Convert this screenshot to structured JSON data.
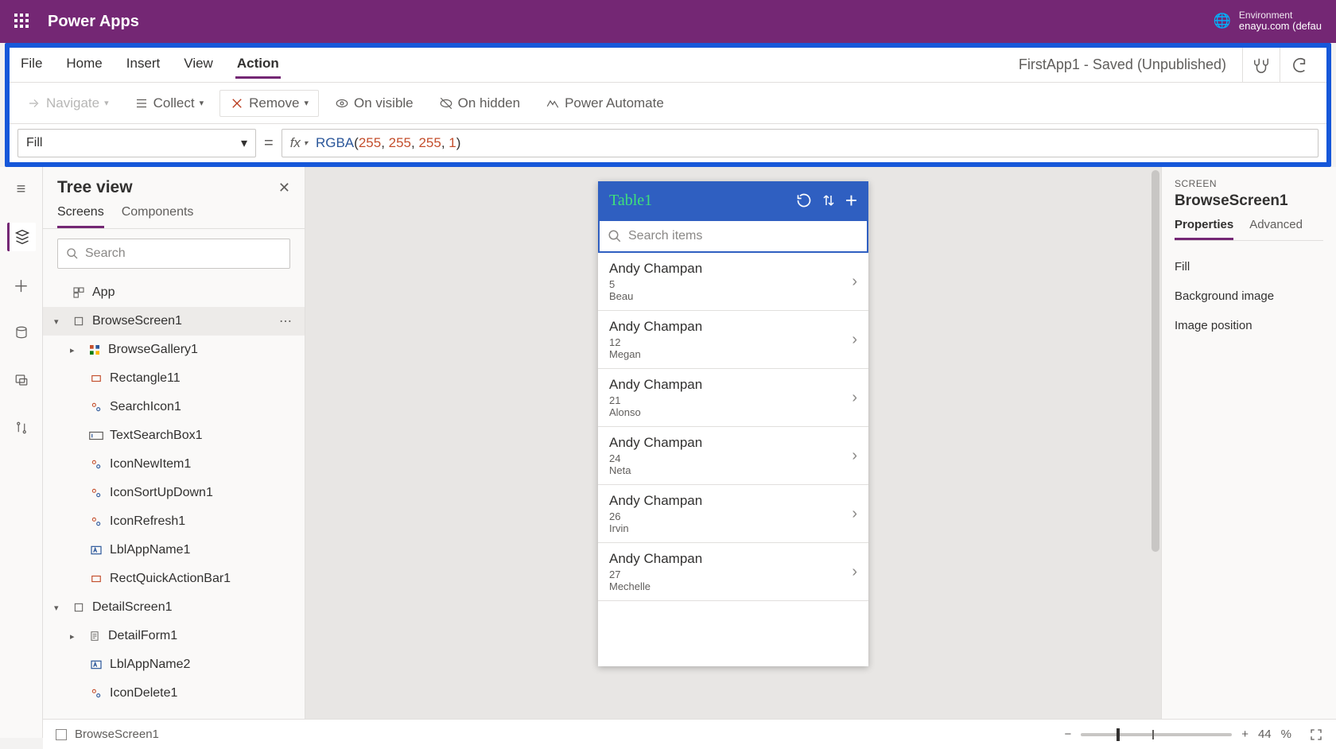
{
  "titlebar": {
    "app": "Power Apps",
    "env_label": "Environment",
    "env_value": "enayu.com (defau"
  },
  "menu": {
    "items": [
      "File",
      "Home",
      "Insert",
      "View",
      "Action"
    ],
    "active": "Action",
    "doc_status": "FirstApp1 - Saved (Unpublished)"
  },
  "toolbar": {
    "navigate": "Navigate",
    "collect": "Collect",
    "remove": "Remove",
    "on_visible": "On visible",
    "on_hidden": "On hidden",
    "power_automate": "Power Automate"
  },
  "formula": {
    "property": "Fill",
    "fx": "fx",
    "fn": "RGBA",
    "args": [
      "255",
      "255",
      "255",
      "1"
    ]
  },
  "treeview": {
    "title": "Tree view",
    "tabs": [
      "Screens",
      "Components"
    ],
    "search_placeholder": "Search",
    "nodes": {
      "app": "App",
      "browse": "BrowseScreen1",
      "gallery": "BrowseGallery1",
      "rect11": "Rectangle11",
      "searchicon": "SearchIcon1",
      "textsearch": "TextSearchBox1",
      "iconnew": "IconNewItem1",
      "iconsort": "IconSortUpDown1",
      "iconrefresh": "IconRefresh1",
      "lblapp": "LblAppName1",
      "rectquick": "RectQuickActionBar1",
      "detail": "DetailScreen1",
      "detailform": "DetailForm1",
      "lblapp2": "LblAppName2",
      "icondelete": "IconDelete1"
    }
  },
  "phone": {
    "title": "Table1",
    "search_placeholder": "Search items",
    "rows": [
      {
        "name": "Andy Champan",
        "n": "5",
        "sub": "Beau"
      },
      {
        "name": "Andy Champan",
        "n": "12",
        "sub": "Megan"
      },
      {
        "name": "Andy Champan",
        "n": "21",
        "sub": "Alonso"
      },
      {
        "name": "Andy Champan",
        "n": "24",
        "sub": "Neta"
      },
      {
        "name": "Andy Champan",
        "n": "26",
        "sub": "Irvin"
      },
      {
        "name": "Andy Champan",
        "n": "27",
        "sub": "Mechelle"
      }
    ]
  },
  "props": {
    "cat": "SCREEN",
    "name": "BrowseScreen1",
    "tabs": [
      "Properties",
      "Advanced"
    ],
    "rows": [
      "Fill",
      "Background image",
      "Image position"
    ]
  },
  "status": {
    "breadcrumb": "BrowseScreen1",
    "zoom": "44",
    "pct": "%"
  }
}
